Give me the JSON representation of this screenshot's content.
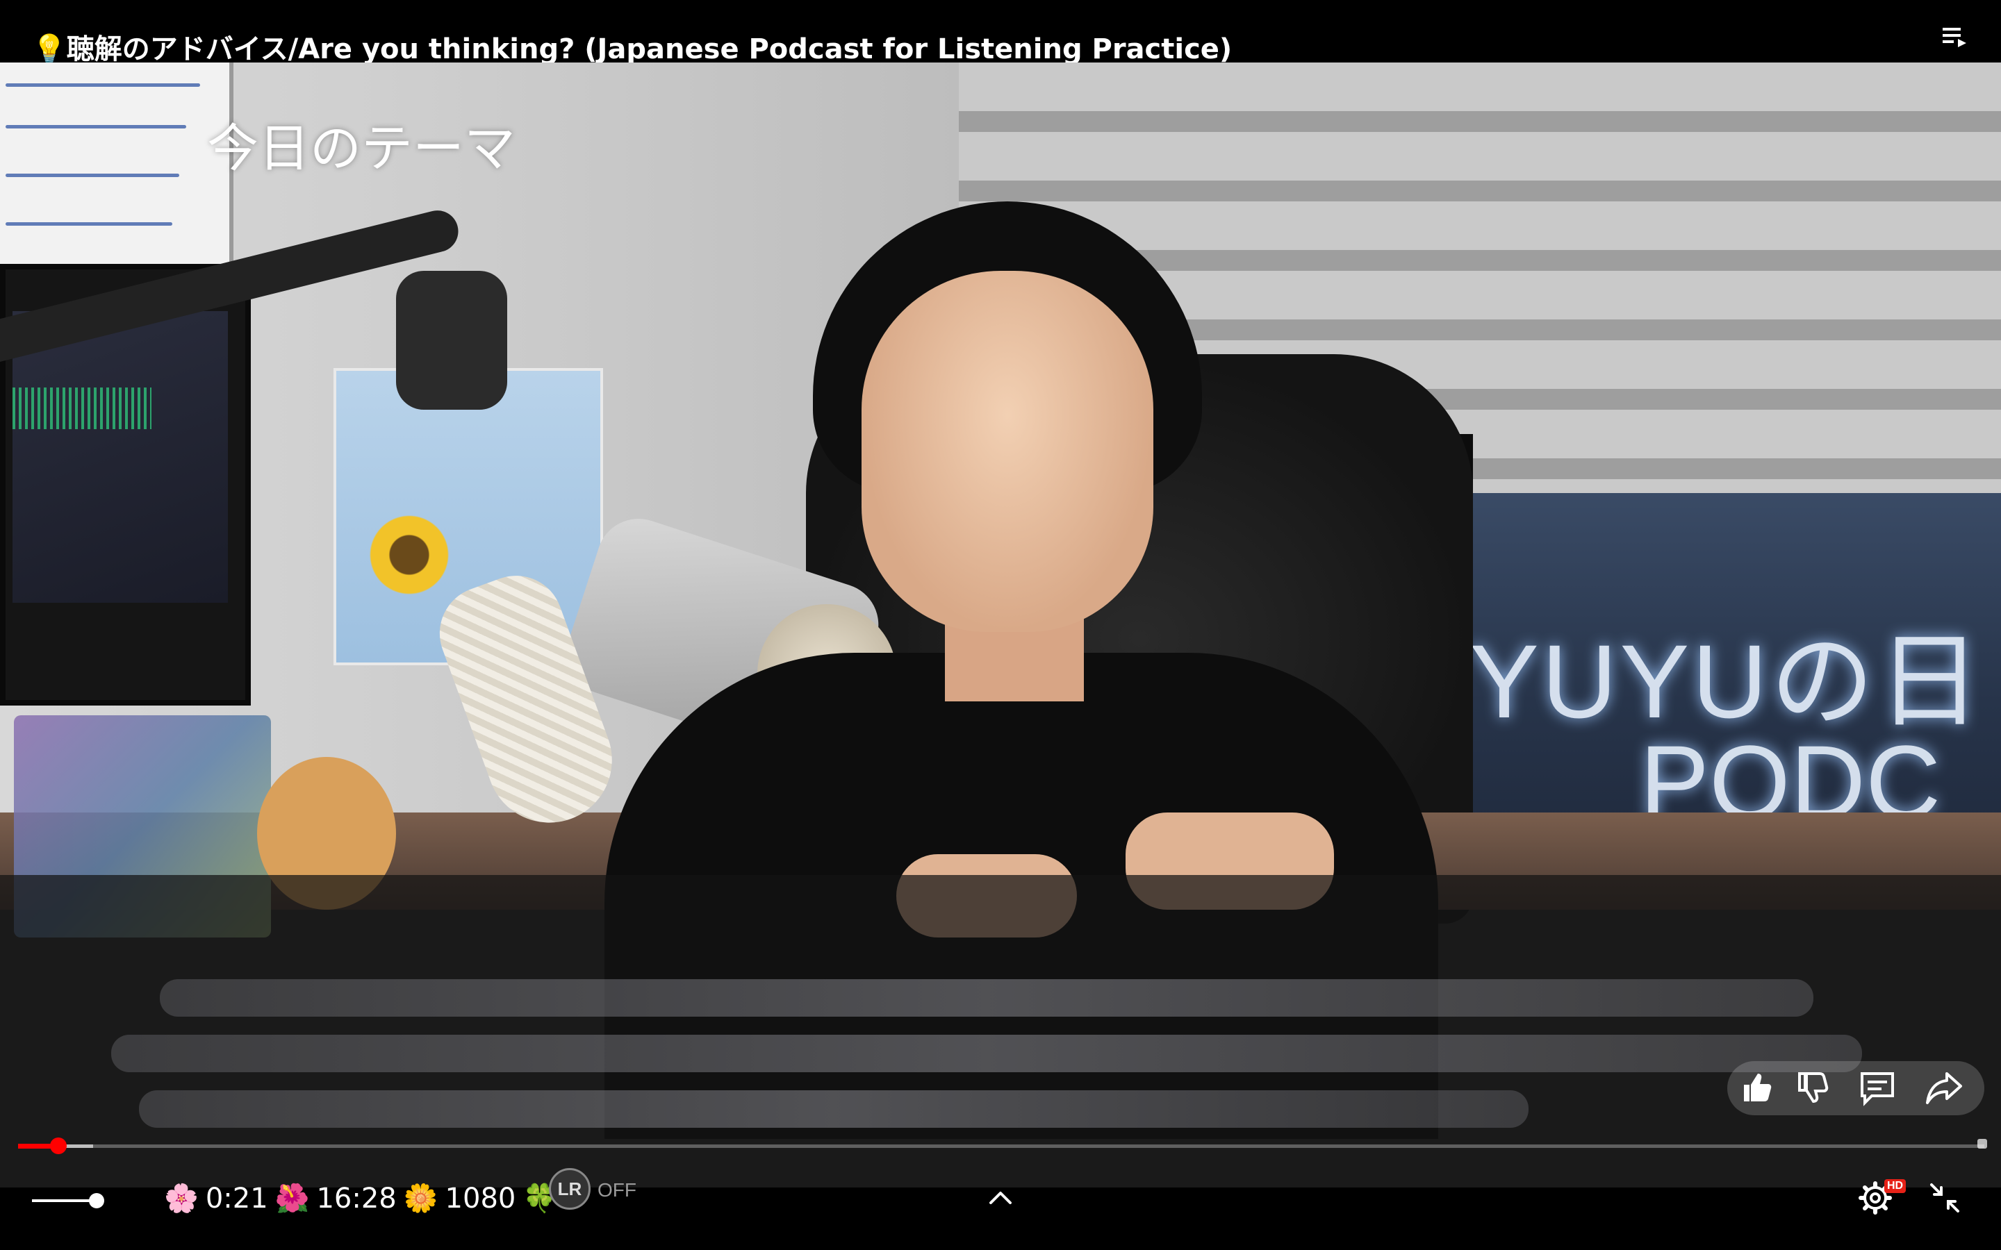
{
  "header": {
    "title": "💡聴解のアドバイス/Are you thinking? (Japanese Podcast for Listening Practice)",
    "playlist_icon": "playlist-icon"
  },
  "video": {
    "overlay_title": "今日のテーマ",
    "subtitle_state": "blurred"
  },
  "actions": {
    "like_icon": "thumb-up-icon",
    "dislike_icon": "thumb-down-icon",
    "comments_icon": "comment-icon",
    "share_icon": "share-icon"
  },
  "progress": {
    "played_fraction": 0.0013,
    "accent_color": "#ff0000"
  },
  "controls": {
    "volume_fraction": 0.9,
    "stats": {
      "icon1": "🌸",
      "current_time": "0:21",
      "icon2": "🌺",
      "duration": "16:28",
      "icon3": "🌼",
      "quality": "1080",
      "icon4": "🍀"
    },
    "lr_label": "LR",
    "lr_state": "OFF",
    "hd_badge": "HD",
    "settings_icon": "gear-icon",
    "exit_fullscreen_icon": "exit-fullscreen-icon",
    "expand_icon": "chevron-up-icon"
  }
}
